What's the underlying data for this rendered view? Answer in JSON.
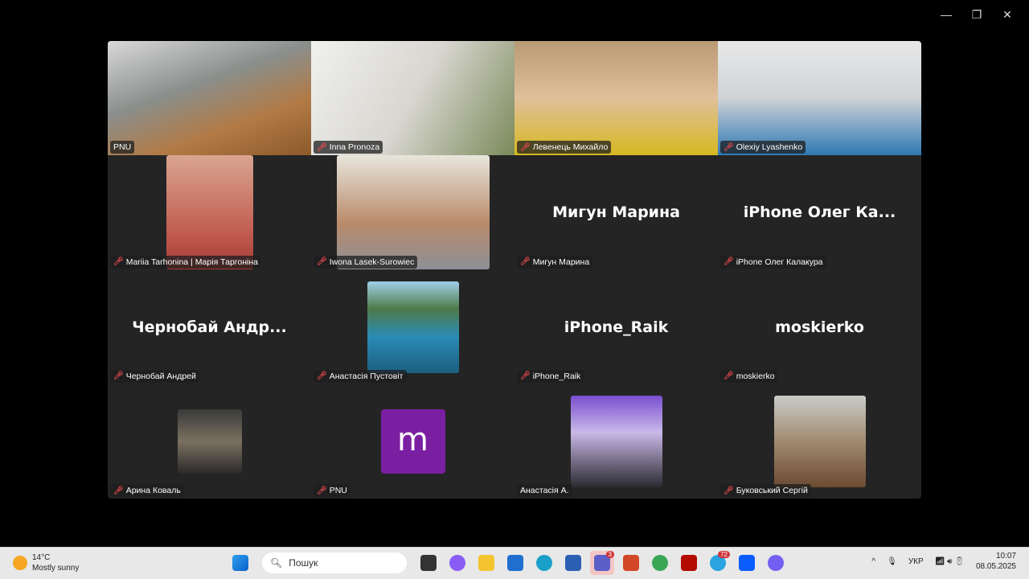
{
  "window_controls": {
    "minimize": "—",
    "restore": "❐",
    "close": "✕"
  },
  "tiles": [
    {
      "name": "PNU",
      "muted": false,
      "active": true,
      "bg": "linear-gradient(160deg,#d9d9d9 0%,#8a8f8c 40%,#b27a45 70%,#8b5a2b 100%)"
    },
    {
      "name": "Inna Pronoza",
      "muted": true,
      "bg": "linear-gradient(120deg,#f0f0ee,#d8d6d0 50%,#7b8a5a 100%)"
    },
    {
      "name": "Левенець Михайло",
      "muted": true,
      "bg": "linear-gradient(180deg,#b99a74,#e0c09a 50%,#d6b821 100%)"
    },
    {
      "name": "Olexiy Lyashenko",
      "muted": true,
      "bg": "linear-gradient(180deg,#e8e8e8,#cfd3d6 50%,#2f78b4 100%)"
    },
    {
      "name": "Mariia Tarhonina | Марія Таргоніна",
      "muted": true,
      "photo": "linear-gradient(180deg,#d9a590,#c05a4f 70%,#a33a35)",
      "pw": 108,
      "ph": 142
    },
    {
      "name": "Iwona Lasek-Surowiec",
      "muted": true,
      "photo": "linear-gradient(180deg,#e8e6dc,#b98a6a 60%,#8c9098)",
      "pw": 190,
      "ph": 142
    },
    {
      "name": "Мигун Марина",
      "muted": true,
      "display": "Мигун Марина"
    },
    {
      "name": "iPhone Олег Калакура",
      "muted": true,
      "display": "iPhone  Олег  Ка..."
    },
    {
      "name": "Чернобай Андрей",
      "muted": true,
      "display": "Чернобай  Андр..."
    },
    {
      "name": "Анастасія Пустовіт",
      "muted": true,
      "photo": "linear-gradient(180deg,#9fd0e8,#4e7a4a 30%,#2b8bb5 60%,#1c5f80)",
      "pw": 114,
      "ph": 114
    },
    {
      "name": "iPhone_Raik",
      "muted": true,
      "display": "iPhone_Raik"
    },
    {
      "name": "moskierko",
      "muted": true,
      "display": "moskierko"
    },
    {
      "name": "Арина Коваль",
      "muted": true,
      "photo": "linear-gradient(180deg,#3a3a3a,#7a7060 50%,#2a2a2a)",
      "pw": 80,
      "ph": 80
    },
    {
      "name": "PNU",
      "muted": true,
      "avatar": "m",
      "avatar_color": "#7b1fa2"
    },
    {
      "name": "Анастасія А.",
      "muted": false,
      "photo": "linear-gradient(180deg,#7a4fd0,#c9b8e8 40%,#2a2a30)",
      "pw": 114,
      "ph": 114
    },
    {
      "name": "Буковський Сергій",
      "muted": true,
      "photo": "linear-gradient(180deg,#c9ccc8,#a08a70 50%,#6b4a30)",
      "pw": 114,
      "ph": 114
    }
  ],
  "taskbar": {
    "weather_temp": "14°C",
    "weather_desc": "Mostly sunny",
    "search_placeholder": "Пошук",
    "apps": [
      {
        "name": "task-view",
        "color": "#333"
      },
      {
        "name": "copilot",
        "color": "#8a5cf6"
      },
      {
        "name": "file-explorer",
        "color": "#f4c430"
      },
      {
        "name": "microsoft-store",
        "color": "#1e6fd0"
      },
      {
        "name": "edge",
        "color": "#1aa0c8"
      },
      {
        "name": "word",
        "color": "#2b5fb4"
      },
      {
        "name": "teams",
        "color": "#5b5fc7",
        "badge": "3",
        "highlight": true
      },
      {
        "name": "powerpoint",
        "color": "#d24726"
      },
      {
        "name": "chrome",
        "color": "#3aa757"
      },
      {
        "name": "acrobat",
        "color": "#b30b00"
      },
      {
        "name": "telegram",
        "color": "#2aa3e0",
        "badge": "72"
      },
      {
        "name": "zoom",
        "color": "#0b5cff"
      },
      {
        "name": "viber",
        "color": "#7360f2"
      }
    ],
    "language": "УКР",
    "time": "10:07",
    "date": "08.05.2025"
  }
}
